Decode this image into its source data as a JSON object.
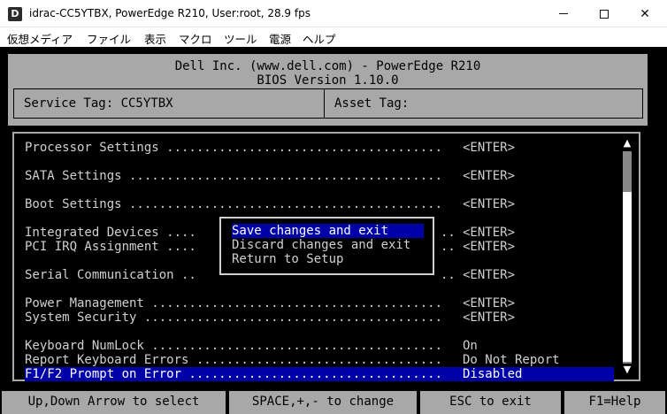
{
  "window": {
    "title": "idrac-CC5YTBX, PowerEdge R210, User:root, 28.9 fps",
    "app_icon_letter": "D",
    "minimize_icon": "minimize-icon",
    "maximize_icon": "maximize-icon",
    "close_glyph": "✕"
  },
  "menubar": {
    "items": [
      "仮想メディア",
      "ファイル",
      "表示",
      "マクロ",
      "ツール",
      "電源",
      "ヘルプ"
    ]
  },
  "bios": {
    "header_line1": "Dell Inc. (www.dell.com) - PowerEdge R210",
    "header_line2": "BIOS Version 1.10.0",
    "service_tag_label": "Service Tag: CC5YTBX",
    "asset_tag_label": "Asset Tag:",
    "rows": [
      {
        "label": "Processor Settings .....................................",
        "value": "<ENTER>"
      },
      {
        "label": "SATA Settings ..........................................",
        "value": "<ENTER>"
      },
      {
        "label": "Boot Settings ..........................................",
        "value": "<ENTER>"
      },
      {
        "label": "Integrated Devices ....",
        "dots_right": "..",
        "value": "<ENTER>"
      },
      {
        "label": "PCI IRQ Assignment ....",
        "dots_right": "..",
        "value": "<ENTER>"
      },
      {
        "label": "Serial Communication ..",
        "dots_right": "..",
        "value": "<ENTER>"
      },
      {
        "label": "Power Management .......................................",
        "value": "<ENTER>"
      },
      {
        "label": "System Security ........................................",
        "value": "<ENTER>"
      },
      {
        "label": "Keyboard NumLock .......................................",
        "value": "On"
      },
      {
        "label": "Report Keyboard Errors .................................",
        "value": "Do Not Report"
      },
      {
        "label": "F1/F2 Prompt on Error ..................................",
        "value": "Disabled"
      }
    ],
    "scroll_up_glyph": "▲",
    "scroll_down_glyph": "▼",
    "exit_dialog": {
      "options": [
        "Save changes and exit",
        "Discard changes and exit",
        "Return to Setup"
      ],
      "selected_index": 0
    },
    "status_bar": [
      "Up,Down Arrow to select",
      "SPACE,+,- to change",
      "ESC to exit",
      "F1=Help"
    ]
  },
  "colors": {
    "bios_background": "#000000",
    "panel_gray": "#a8a8a8",
    "highlight_blue": "#0000a8",
    "text_light": "#d0d0d0"
  }
}
